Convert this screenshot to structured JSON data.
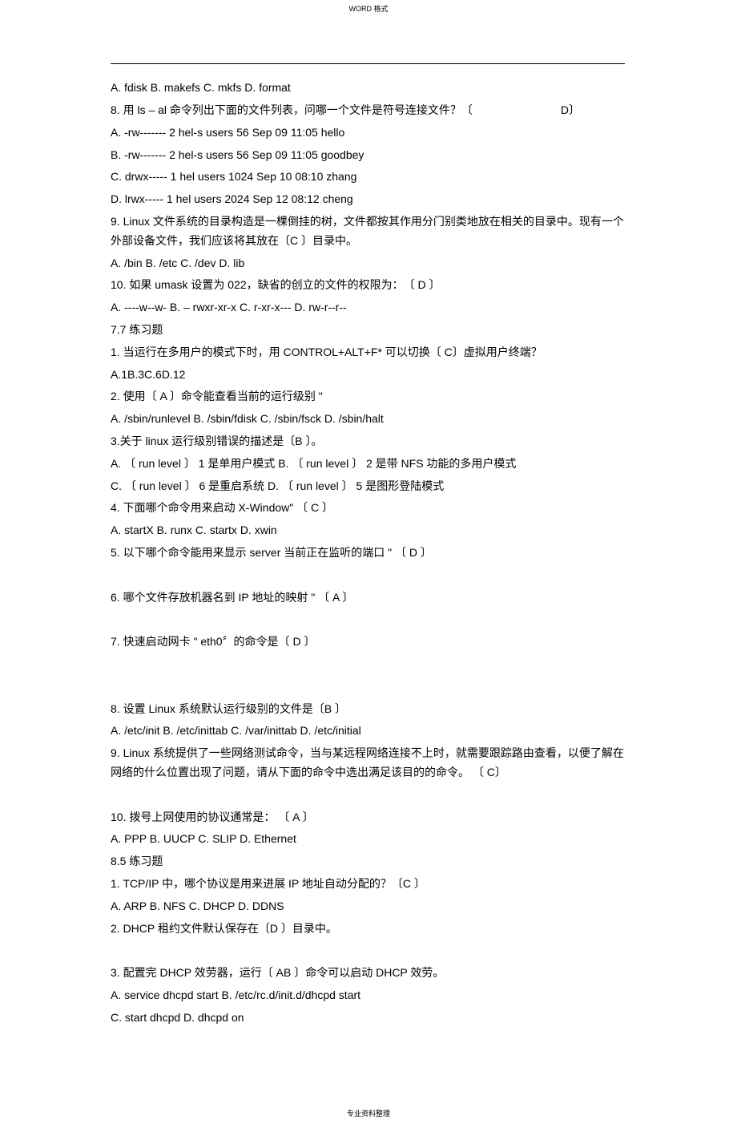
{
  "header": "WORD 格式",
  "footer": "专业资料整理",
  "lines": {
    "l1": "A. fdisk B. makefs C. mkfs D. format",
    "l2a": "8. 用 ls – al 命令列出下面的文件列表，问哪一个文件是符号连接文件？〔",
    "l2b": "D〕",
    "l3": "A. -rw------- 2 hel-s users 56 Sep 09 11:05 hello",
    "l4": "B. -rw------- 2 hel-s users 56 Sep 09 11:05 goodbey",
    "l5": "C. drwx----- 1 hel users 1024 Sep 10 08:10 zhang",
    "l6": "D. lrwx----- 1 hel users 2024 Sep 12 08:12 cheng",
    "l7": "9. Linux  文件系统的目录构造是一棵倒挂的树，文件都按其作用分门别类地放在相关的目录中。现有一个外部设备文件，我们应该将其放在〔C 〕目录中。",
    "l8": "A. /bin B. /etc C. /dev D. lib",
    "l9": "10.  如果 umask 设置为  022，缺省的创立的文件的权限为：　〔 D  〕",
    "l10": "A. ----w--w- B. – rwxr-xr-x C. r-xr-x--- D. rw-r--r--",
    "l11": "7.7 练习题",
    "l12": "1.  当运行在多用户的模式下时，用 CONTROL+ALT+F*  可以切换〔   C〕虚拟用户终端？",
    "l13": "A.1B.3C.6D.12",
    "l14": "2.  使用〔  A 〕命令能查看当前的运行级别   \"",
    "l15": "A. /sbin/runlevel B. /sbin/fdisk C. /sbin/fsck D. /sbin/halt",
    "l16": "3.关于 linux 运行级别错误的描述是〔B 〕。",
    "l17": "A.  〔 run level 〕 1  是单用户模式    B.  〔 run level 〕  2 是带 NFS 功能的多用户模式",
    "l18": "C.  〔 run level 〕 6 是重启系统 D.   〔 run level 〕  5 是图形登陆模式",
    "l19": "4. 下面哪个命令用来启动 X-Window\"  〔 C 〕",
    "l20": "A. startX B. runx C. startx D. xwin",
    "l21": "5.  以下哪个命令能用来显示    server 当前正在监听的端口  \" 〔 D 〕",
    "l22": "6.  哪个文件存放机器名到   IP 地址的映射  \" 〔  A  〕",
    "l23": "7.  快速启动网卡 \"  eth0〞的命令是〔  D 〕",
    "l24": "8. 设置 Linux 系统默认运行级别的文件是〔B 〕",
    "l25": "A. /etc/init B. /etc/inittab C. /var/inittab D. /etc/initial",
    "l26": "9. Linux 系统提供了一些网络测试命令，当与某远程网络连接不上时，就需要跟踪路由查看，以便了解在网络的什么位置出现了问题，请从下面的命令中选出满足该目的的命令。 〔 C〕",
    "l27": "10.  拨号上网使用的协议通常是：    〔 A 〕",
    "l28": "A. PPP B. UUCP C. SLIP D. Ethernet",
    "l29": "8.5 练习题",
    "l30": "1. TCP/IP  中，哪个协议是用来进展 IP 地址自动分配的？〔C 〕",
    "l31": "A. ARP B. NFS C. DHCP D. DDNS",
    "l32": "2. DHCP  租约文件默认保存在〔D 〕目录中。",
    "l33": "3.  配置完 DHCP  效劳器，运行〔   AB  〕命令可以启动   DHCP  效劳。",
    "l34": "A. service dhcpd start B. /etc/rc.d/init.d/dhcpd start",
    "l35": "C. start dhcpd D. dhcpd on"
  }
}
